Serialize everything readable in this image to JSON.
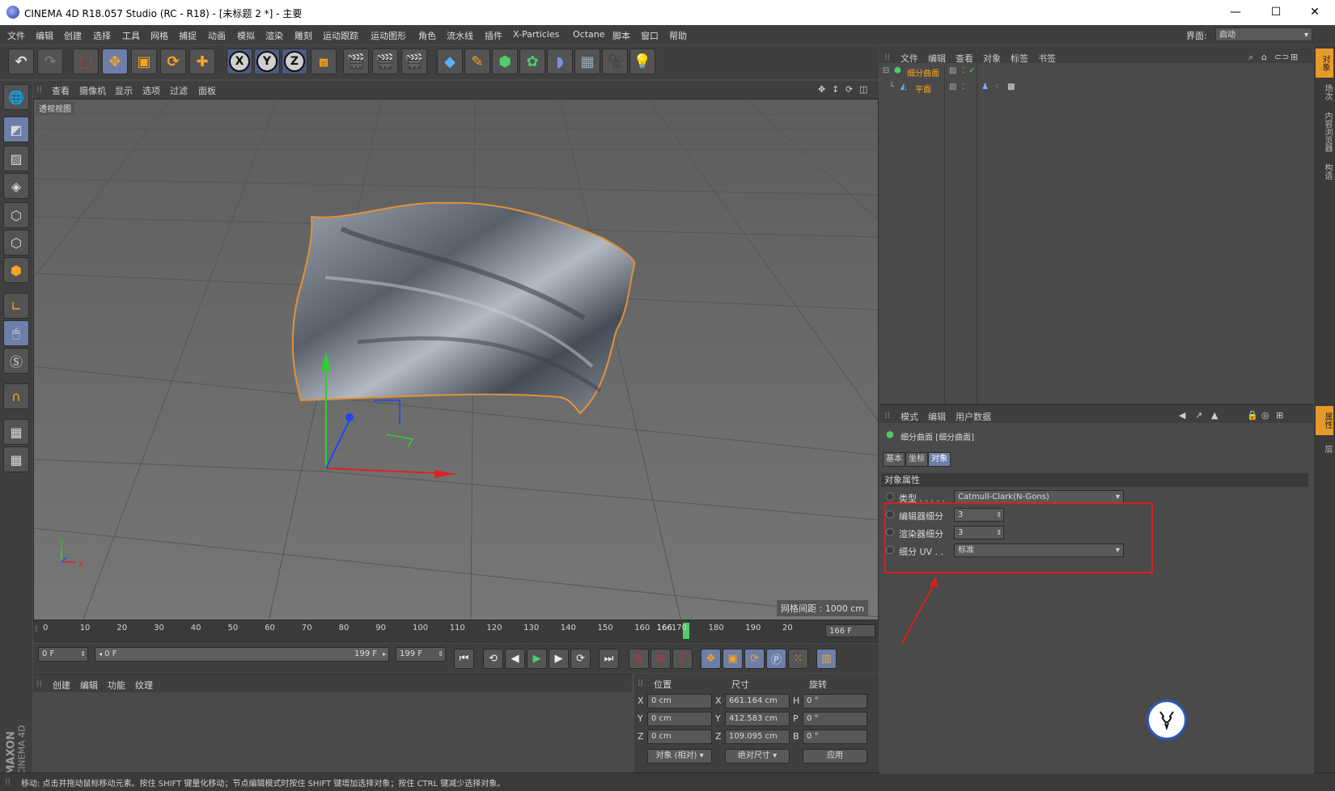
{
  "window": {
    "title": "CINEMA 4D R18.057 Studio (RC - R18) - [未标题 2 *] - 主要",
    "minimize": "—",
    "maximize": "☐",
    "close": "✕"
  },
  "menubar": {
    "items": [
      "文件",
      "编辑",
      "创建",
      "选择",
      "工具",
      "网格",
      "捕捉",
      "动画",
      "模拟",
      "渲染",
      "雕刻",
      "运动跟踪",
      "运动图形",
      "角色",
      "流水线",
      "插件",
      "X-Particles",
      "Octane",
      "脚本",
      "窗口",
      "帮助"
    ],
    "layout_label": "界面:",
    "layout_value": "启动"
  },
  "toolbar": {
    "undo_icon": "undo-icon",
    "axis_x": "X",
    "axis_y": "Y",
    "axis_z": "Z"
  },
  "viewport": {
    "menu": [
      "查看",
      "摄像机",
      "显示",
      "选项",
      "过滤",
      "面板"
    ],
    "label": "透视视图",
    "grid_spacing": "网格间距 : 1000 cm",
    "axis_x_letter": "X",
    "axis_y_letter": "Y"
  },
  "timeline": {
    "ticks": [
      "0",
      "10",
      "20",
      "30",
      "40",
      "50",
      "60",
      "70",
      "80",
      "90",
      "100",
      "110",
      "120",
      "130",
      "140",
      "150",
      "160",
      "166",
      "170",
      "180",
      "190",
      "20"
    ],
    "current": "166",
    "frame_display": "166 F"
  },
  "transport": {
    "start_field": "0 F",
    "range_start": "0 F",
    "range_end": "199 F",
    "end_field": "199 F"
  },
  "material_manager": {
    "menu": [
      "创建",
      "编辑",
      "功能",
      "纹理"
    ]
  },
  "coords": {
    "headers": [
      "位置",
      "尺寸",
      "旋转"
    ],
    "rows": [
      {
        "axis": "X",
        "pos": "0 cm",
        "size_axis": "X",
        "size": "661.164 cm",
        "rot_axis": "H",
        "rot": "0 °"
      },
      {
        "axis": "Y",
        "pos": "0 cm",
        "size_axis": "Y",
        "size": "412.583 cm",
        "rot_axis": "P",
        "rot": "0 °"
      },
      {
        "axis": "Z",
        "pos": "0 cm",
        "size_axis": "Z",
        "size": "109.095 cm",
        "rot_axis": "B",
        "rot": "0 °"
      }
    ],
    "mode_select": "对象 (相对)",
    "size_select": "绝对尺寸",
    "apply": "应用"
  },
  "maxon_logo": {
    "line1": "MAXON",
    "line2": "CINEMA 4D"
  },
  "object_manager": {
    "menu": [
      "文件",
      "编辑",
      "查看",
      "对象",
      "标签",
      "书签"
    ],
    "objects": [
      {
        "name": "细分曲面",
        "depth": 0
      },
      {
        "name": "平面",
        "depth": 1
      }
    ]
  },
  "attribute_manager": {
    "menu": [
      "模式",
      "编辑",
      "用户数据"
    ],
    "object_title": "细分曲面 [细分曲面]",
    "tabs": [
      "基本",
      "坐标",
      "对象"
    ],
    "active_tab": "对象",
    "section": "对象属性",
    "props": [
      {
        "label": "类型 . . . . .",
        "value": "Catmull-Clark(N-Gons)"
      },
      {
        "label": "编辑器细分",
        "value": "3"
      },
      {
        "label": "渲染器细分",
        "value": "3"
      },
      {
        "label": "细分 UV . .",
        "value": "标准"
      }
    ]
  },
  "sidetabs": {
    "top": [
      "对象",
      "场次",
      "内容浏览器",
      "构造"
    ],
    "bottom": [
      "属性",
      "层"
    ]
  },
  "status": {
    "text": "移动: 点击并拖动鼠标移动元素。按住 SHIFT 键量化移动；节点编辑模式时按住 SHIFT 键增加选择对象；按住 CTRL 键减少选择对象。"
  },
  "colors": {
    "accent_orange": "#f5a623",
    "selection_blue": "#6d7ea8",
    "highlight_red": "#d92020",
    "timeline_marker": "#4ecc6a"
  }
}
